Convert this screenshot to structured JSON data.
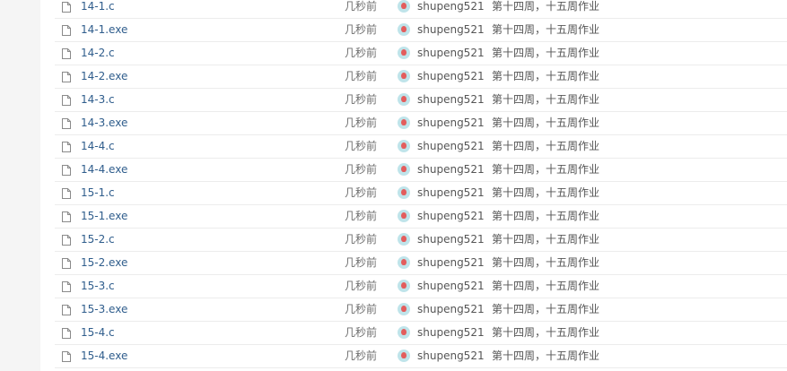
{
  "files": [
    {
      "name": "14-1.c",
      "time": "几秒前",
      "author": "shupeng521",
      "message": "第十四周，十五周作业"
    },
    {
      "name": "14-1.exe",
      "time": "几秒前",
      "author": "shupeng521",
      "message": "第十四周，十五周作业"
    },
    {
      "name": "14-2.c",
      "time": "几秒前",
      "author": "shupeng521",
      "message": "第十四周，十五周作业"
    },
    {
      "name": "14-2.exe",
      "time": "几秒前",
      "author": "shupeng521",
      "message": "第十四周，十五周作业"
    },
    {
      "name": "14-3.c",
      "time": "几秒前",
      "author": "shupeng521",
      "message": "第十四周，十五周作业"
    },
    {
      "name": "14-3.exe",
      "time": "几秒前",
      "author": "shupeng521",
      "message": "第十四周，十五周作业"
    },
    {
      "name": "14-4.c",
      "time": "几秒前",
      "author": "shupeng521",
      "message": "第十四周，十五周作业"
    },
    {
      "name": "14-4.exe",
      "time": "几秒前",
      "author": "shupeng521",
      "message": "第十四周，十五周作业"
    },
    {
      "name": "15-1.c",
      "time": "几秒前",
      "author": "shupeng521",
      "message": "第十四周，十五周作业"
    },
    {
      "name": "15-1.exe",
      "time": "几秒前",
      "author": "shupeng521",
      "message": "第十四周，十五周作业"
    },
    {
      "name": "15-2.c",
      "time": "几秒前",
      "author": "shupeng521",
      "message": "第十四周，十五周作业"
    },
    {
      "name": "15-2.exe",
      "time": "几秒前",
      "author": "shupeng521",
      "message": "第十四周，十五周作业"
    },
    {
      "name": "15-3.c",
      "time": "几秒前",
      "author": "shupeng521",
      "message": "第十四周，十五周作业"
    },
    {
      "name": "15-3.exe",
      "time": "几秒前",
      "author": "shupeng521",
      "message": "第十四周，十五周作业"
    },
    {
      "name": "15-4.c",
      "time": "几秒前",
      "author": "shupeng521",
      "message": "第十四周，十五周作业"
    },
    {
      "name": "15-4.exe",
      "time": "几秒前",
      "author": "shupeng521",
      "message": "第十四周，十五周作业"
    }
  ],
  "icons": {
    "file": "file-icon",
    "avatar": "user-avatar"
  },
  "colors": {
    "link": "#2f5d8c",
    "text": "#555555",
    "divider": "#ececec",
    "background": "#f5f5f5"
  }
}
